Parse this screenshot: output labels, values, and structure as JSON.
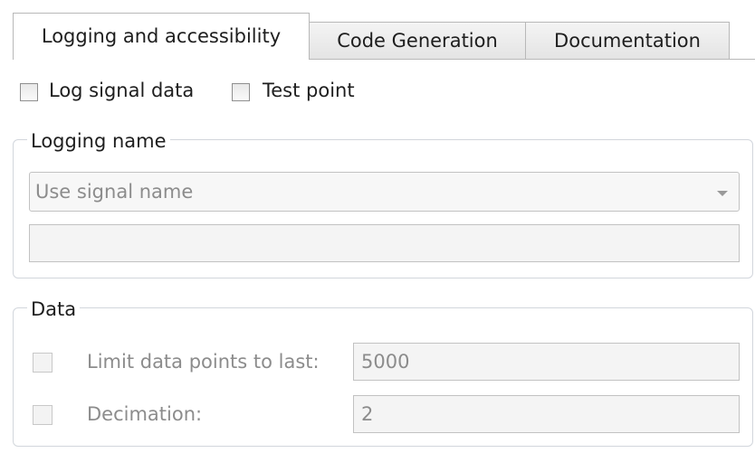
{
  "tabs": [
    {
      "label": "Logging and accessibility",
      "active": true
    },
    {
      "label": "Code Generation",
      "active": false
    },
    {
      "label": "Documentation",
      "active": false
    }
  ],
  "options": {
    "log_signal_data": {
      "label": "Log signal data",
      "checked": false
    },
    "test_point": {
      "label": "Test point",
      "checked": false
    }
  },
  "logging_name": {
    "title": "Logging name",
    "select_value": "Use signal name",
    "name_field_value": ""
  },
  "data_group": {
    "title": "Data",
    "limit": {
      "label": "Limit data points to last:",
      "value": "5000",
      "checked": false,
      "enabled": false
    },
    "decimation": {
      "label": "Decimation:",
      "value": "2",
      "checked": false,
      "enabled": false
    }
  }
}
